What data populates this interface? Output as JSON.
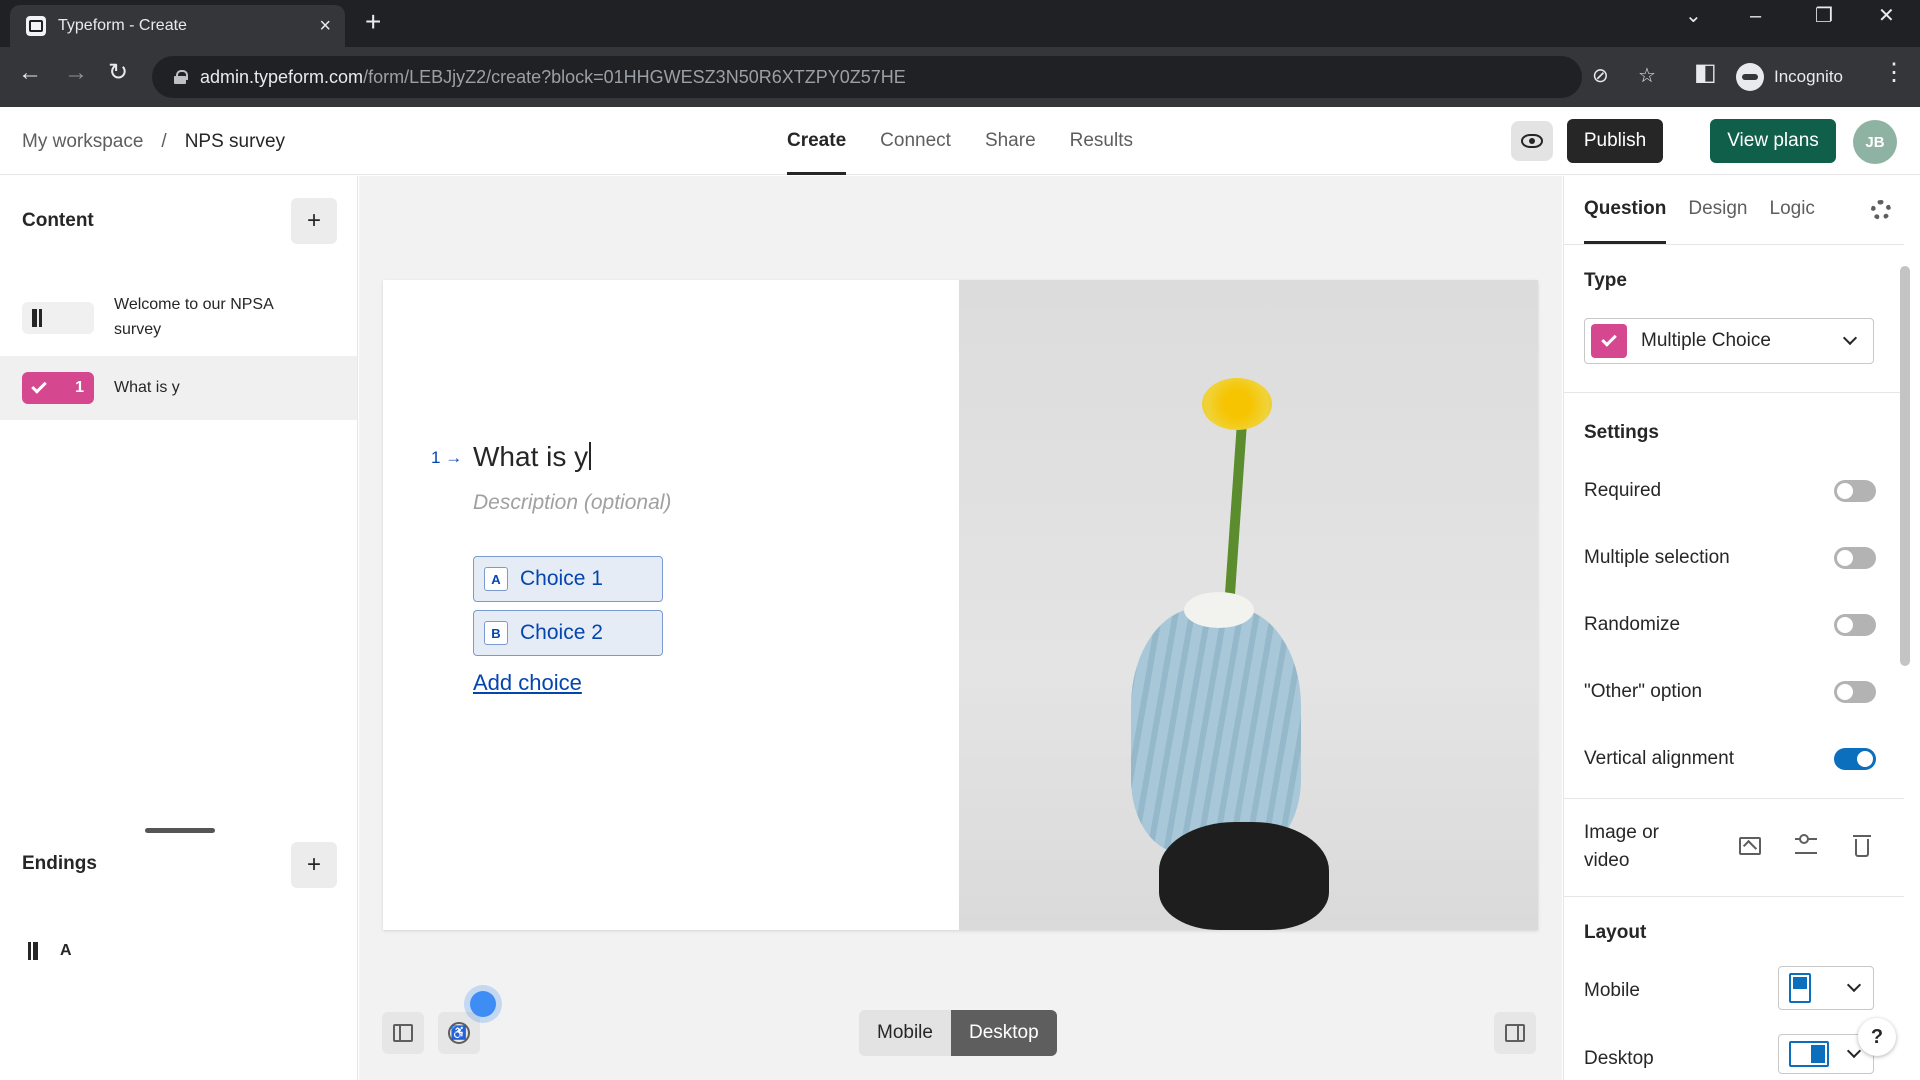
{
  "browser": {
    "tab_title": "Typeform - Create",
    "url_host": "admin.typeform.com",
    "url_path": "/form/LEBJjyZ2/create?block=01HHGWESZ3N50R6XTZPY0Z57HE",
    "incognito_label": "Incognito"
  },
  "header": {
    "breadcrumb": [
      "My workspace",
      "/",
      "NPS survey"
    ],
    "tabs": [
      {
        "label": "Create",
        "active": true
      },
      {
        "label": "Connect",
        "active": false
      },
      {
        "label": "Share",
        "active": false
      },
      {
        "label": "Results",
        "active": false
      }
    ],
    "publish_label": "Publish",
    "view_plans_label": "View plans",
    "avatar_initials": "JB"
  },
  "sidebar": {
    "content_title": "Content",
    "items": [
      {
        "label": "Welcome to our NPSA survey",
        "type": "welcome-screen"
      },
      {
        "label": "What is y",
        "number": "1",
        "type": "multiple-choice",
        "selected": true
      }
    ],
    "endings_title": "Endings",
    "ending_letter": "A"
  },
  "question": {
    "number": "1",
    "arrow": "→",
    "title": "What is y",
    "description_placeholder": "Description (optional)",
    "choices": [
      {
        "key": "A",
        "label": "Choice 1"
      },
      {
        "key": "B",
        "label": "Choice 2"
      }
    ],
    "add_choice_label": "Add choice"
  },
  "view_toggle": {
    "options": [
      "Mobile",
      "Desktop"
    ],
    "selected": "Desktop"
  },
  "right_panel": {
    "tabs": [
      {
        "label": "Question",
        "active": true
      },
      {
        "label": "Design",
        "active": false
      },
      {
        "label": "Logic",
        "active": false
      }
    ],
    "type_heading": "Type",
    "type_value": "Multiple Choice",
    "settings_heading": "Settings",
    "settings": [
      {
        "label": "Required",
        "on": false
      },
      {
        "label": "Multiple selection",
        "on": false
      },
      {
        "label": "Randomize",
        "on": false
      },
      {
        "label": "\"Other\" option",
        "on": false
      },
      {
        "label": "Vertical alignment",
        "on": true
      }
    ],
    "image_or_video_label_line1": "Image or",
    "image_or_video_label_line2": "video",
    "layout_heading": "Layout",
    "layout_mobile_label": "Mobile",
    "layout_desktop_label": "Desktop"
  },
  "help_label": "?",
  "colors": {
    "multiple_choice_pink": "#d54890",
    "typeform_blue": "#0445af",
    "toggle_on": "#0b6fbd",
    "view_plans_green": "#0f5f4a"
  }
}
